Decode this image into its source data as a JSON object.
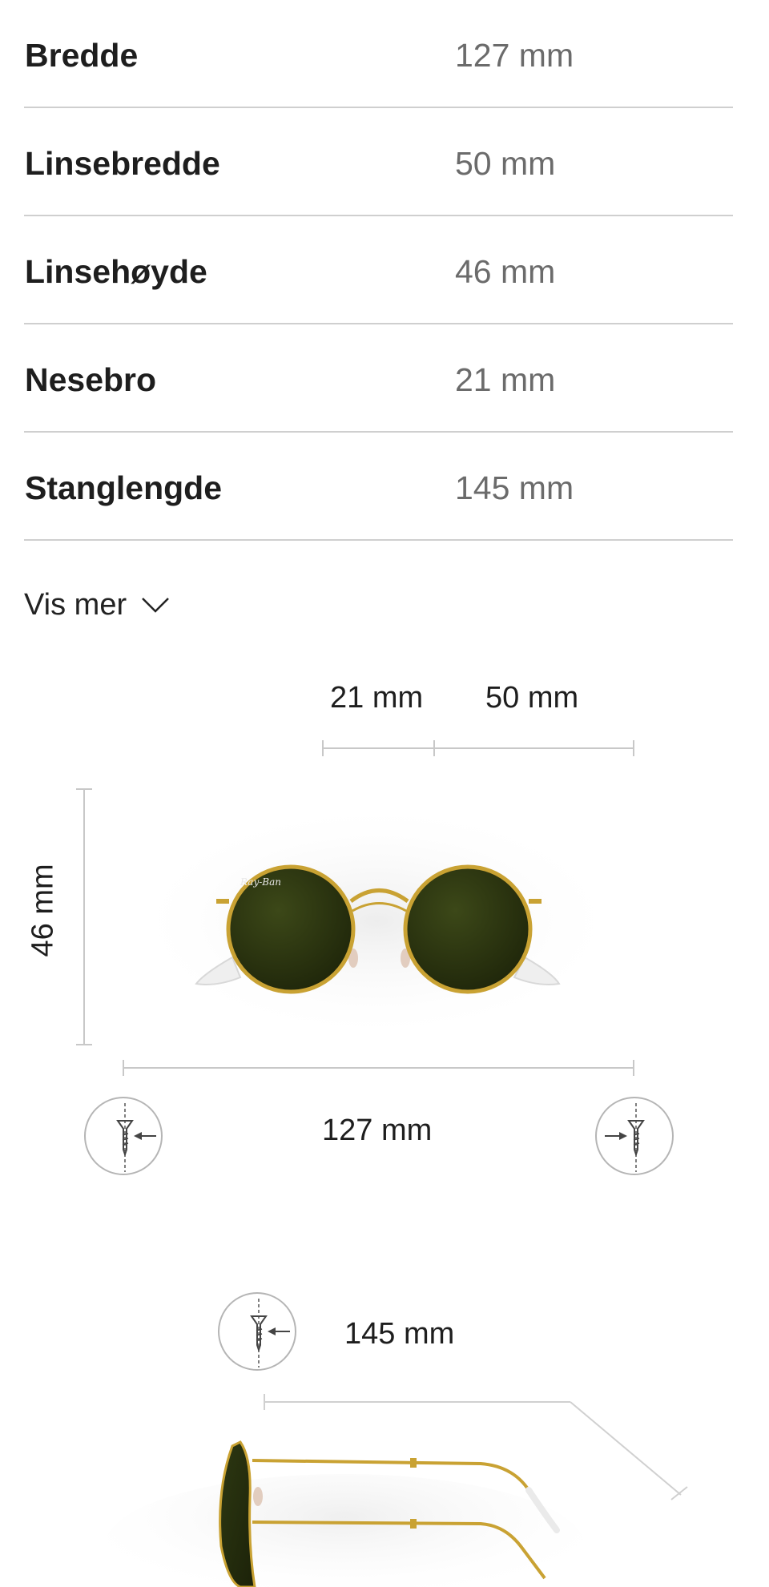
{
  "specs": [
    {
      "label": "Bredde",
      "value": "127 mm"
    },
    {
      "label": "Linsebredde",
      "value": "50 mm"
    },
    {
      "label": "Linsehøyde",
      "value": "46 mm"
    },
    {
      "label": "Nesebro",
      "value": "21 mm"
    },
    {
      "label": "Stanglengde",
      "value": "145 mm"
    }
  ],
  "show_more": {
    "label": "Vis mer",
    "icon": "chevron-down-icon"
  },
  "diagram": {
    "bridge_width": "21 mm",
    "lens_width": "50 mm",
    "lens_height": "46 mm",
    "total_width": "127 mm",
    "temple_length": "145 mm"
  },
  "colors": {
    "lens": "#2f3a12",
    "frame": "#c9a233",
    "divider": "#cfcfcf",
    "value_text": "#6b6b6b"
  }
}
